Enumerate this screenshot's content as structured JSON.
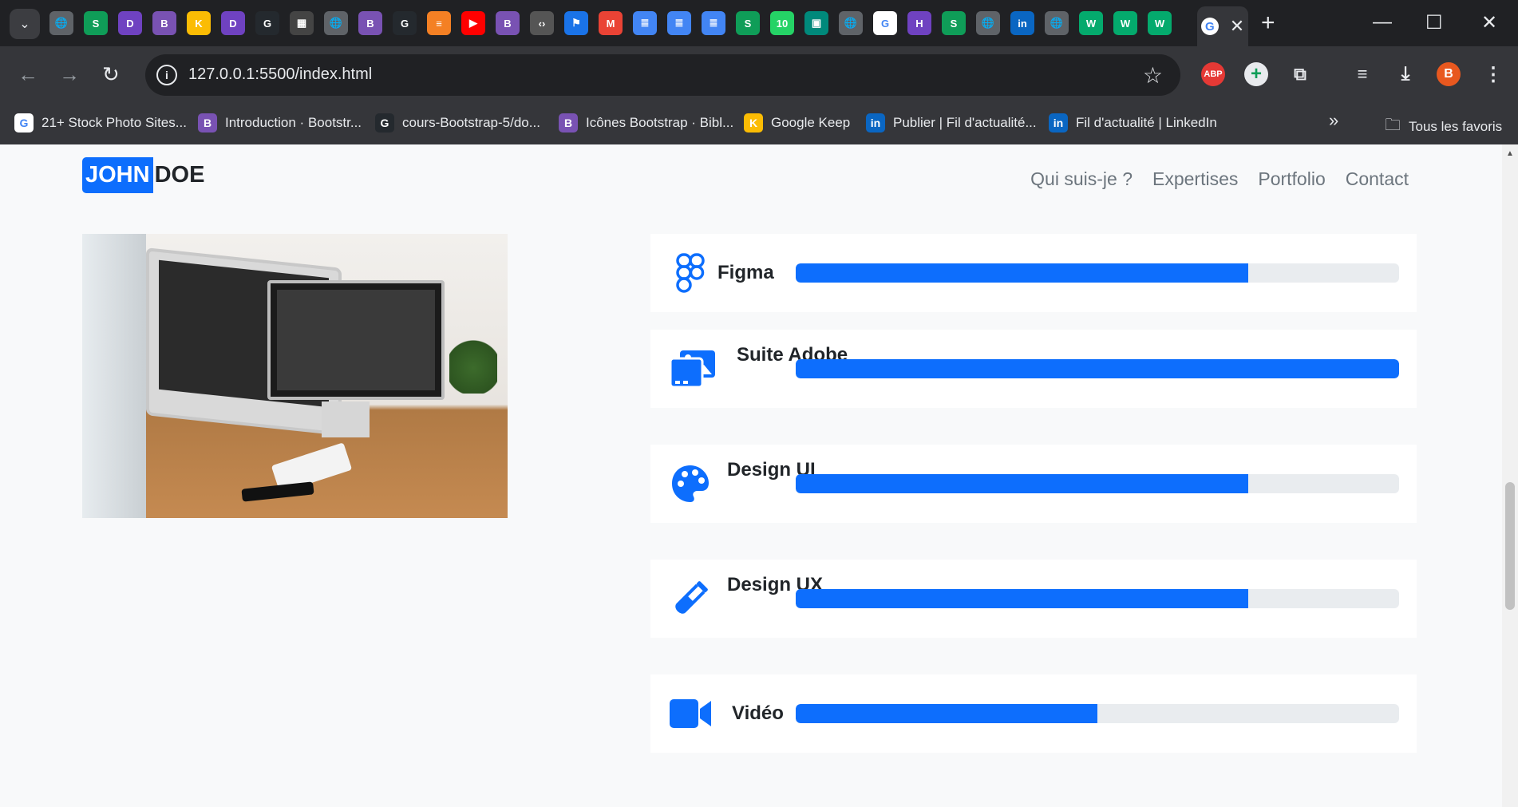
{
  "browser": {
    "tab_icons": [
      {
        "name": "globe",
        "color": "#5f6368",
        "glyph": "🌐"
      },
      {
        "name": "savi",
        "color": "#0f9d58",
        "glyph": "S"
      },
      {
        "name": "d-app",
        "color": "#6f42c1",
        "glyph": "D"
      },
      {
        "name": "bootstrap",
        "color": "#7952b3",
        "glyph": "B"
      },
      {
        "name": "keep",
        "color": "#fbbc04",
        "glyph": "K"
      },
      {
        "name": "d-app",
        "color": "#6f42c1",
        "glyph": "D"
      },
      {
        "name": "github",
        "color": "#24292e",
        "glyph": "G"
      },
      {
        "name": "media",
        "color": "#444",
        "glyph": "▦"
      },
      {
        "name": "globe",
        "color": "#5f6368",
        "glyph": "🌐"
      },
      {
        "name": "bootstrap",
        "color": "#7952b3",
        "glyph": "B"
      },
      {
        "name": "github",
        "color": "#24292e",
        "glyph": "G"
      },
      {
        "name": "stackoverflow",
        "color": "#f48024",
        "glyph": "≡"
      },
      {
        "name": "youtube",
        "color": "#ff0000",
        "glyph": "▶"
      },
      {
        "name": "bootstrap",
        "color": "#7952b3",
        "glyph": "B"
      },
      {
        "name": "code",
        "color": "#555",
        "glyph": "‹›"
      },
      {
        "name": "flag",
        "color": "#1a73e8",
        "glyph": "⚑"
      },
      {
        "name": "gmail",
        "color": "#ea4335",
        "glyph": "M"
      },
      {
        "name": "docs",
        "color": "#4285f4",
        "glyph": "≣"
      },
      {
        "name": "docs",
        "color": "#4285f4",
        "glyph": "≣"
      },
      {
        "name": "docs",
        "color": "#4285f4",
        "glyph": "≣"
      },
      {
        "name": "savi",
        "color": "#0f9d58",
        "glyph": "S"
      },
      {
        "name": "whatsapp",
        "color": "#25d366",
        "glyph": "10"
      },
      {
        "name": "meet",
        "color": "#00897b",
        "glyph": "▣"
      },
      {
        "name": "globe",
        "color": "#5f6368",
        "glyph": "🌐"
      },
      {
        "name": "google",
        "color": "#ffffff",
        "glyph": "G"
      },
      {
        "name": "hackerrank",
        "color": "#6f42c1",
        "glyph": "H"
      },
      {
        "name": "savi",
        "color": "#0f9d58",
        "glyph": "S"
      },
      {
        "name": "globe",
        "color": "#5f6368",
        "glyph": "🌐"
      },
      {
        "name": "linkedin",
        "color": "#0a66c2",
        "glyph": "in"
      },
      {
        "name": "globe",
        "color": "#5f6368",
        "glyph": "🌐"
      },
      {
        "name": "w3",
        "color": "#04aa6d",
        "glyph": "W"
      },
      {
        "name": "w3",
        "color": "#04aa6d",
        "glyph": "W"
      },
      {
        "name": "w3",
        "color": "#04aa6d",
        "glyph": "W"
      }
    ],
    "url": "127.0.0.1:5500/index.html",
    "bookmarks": [
      {
        "label": "21+ Stock Photo Sites...",
        "icon": "G",
        "color": "#ffffff",
        "fg": "#4285f4"
      },
      {
        "label": "Introduction · Bootstr...",
        "icon": "B",
        "color": "#7952b3",
        "fg": "#ffffff"
      },
      {
        "label": "cours-Bootstrap-5/do...",
        "icon": "G",
        "color": "#24292e",
        "fg": "#ffffff"
      },
      {
        "label": "Icônes Bootstrap · Bibl...",
        "icon": "B",
        "color": "#7952b3",
        "fg": "#ffffff"
      },
      {
        "label": "Google Keep",
        "icon": "K",
        "color": "#fbbc04",
        "fg": "#ffffff"
      },
      {
        "label": "Publier | Fil d'actualité...",
        "icon": "in",
        "color": "#0a66c2",
        "fg": "#ffffff"
      },
      {
        "label": "Fil d'actualité | LinkedIn",
        "icon": "in",
        "color": "#0a66c2",
        "fg": "#ffffff"
      }
    ],
    "all_bookmarks": "Tous les favoris",
    "profile_initial": "B"
  },
  "site": {
    "brand_first": "JOHN",
    "brand_last": "DOE",
    "nav": [
      "Qui suis-je ?",
      "Expertises",
      "Portfolio",
      "Contact"
    ]
  },
  "skills": [
    {
      "name": "Figma",
      "icon": "figma-icon",
      "level": 75
    },
    {
      "name": "Suite Adobe",
      "icon": "images-icon",
      "level": 100
    },
    {
      "name": "Design UI",
      "icon": "palette-icon",
      "level": 75
    },
    {
      "name": "Design UX",
      "icon": "test-tube-icon",
      "level": 75
    },
    {
      "name": "Vidéo",
      "icon": "camera-video-icon",
      "level": 50
    }
  ],
  "colors": {
    "primary": "#0d6efd",
    "track": "#e9ecef"
  }
}
